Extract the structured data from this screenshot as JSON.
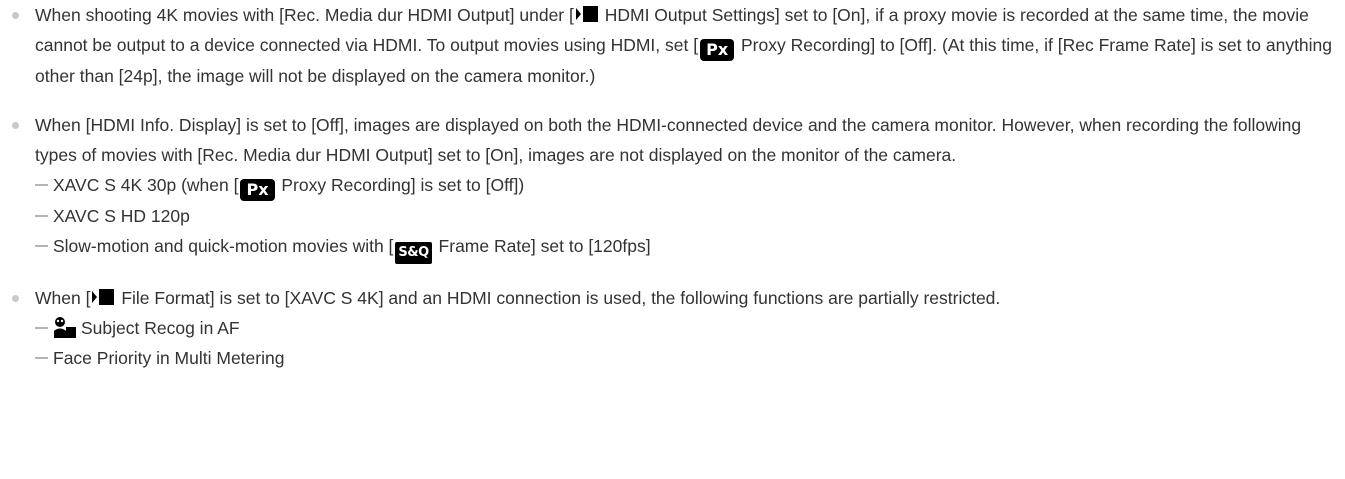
{
  "icons": {
    "movie": "movie-mode-icon",
    "proxy": "Px",
    "sq": "S&Q",
    "face": "subject-recognition-icon"
  },
  "colors": {
    "text": "#333333",
    "badge_bg": "#000000",
    "bullet": "#c8c8c8"
  },
  "note1": {
    "a": "When shooting 4K movies with [Rec. Media dur HDMI Output] under [",
    "b": " HDMI Output Settings] set to [On], if a proxy movie is recorded at the same time, the movie cannot be output to a device connected via HDMI. To output movies using HDMI, set [",
    "c": " Proxy Recording] to [Off]. (At this time, if [Rec Frame Rate] is set to anything other than [24p], the image will not be displayed on the camera monitor.)"
  },
  "note2": {
    "text": "When [HDMI Info. Display] is set to [Off], images are displayed on both the HDMI-connected device and the camera monitor. However, when recording the following types of movies with [Rec. Media dur HDMI Output] set to [On], images are not displayed on the monitor of the camera.",
    "item1": {
      "a": "XAVC S 4K 30p (when [",
      "b": " Proxy Recording] is set to [Off])"
    },
    "item2": "XAVC S HD 120p",
    "item3": {
      "a": "Slow-motion and quick-motion movies with [",
      "b": " Frame Rate] set to [120fps]"
    }
  },
  "note3": {
    "a": "When [",
    "b": " File Format] is set to [XAVC S 4K] and an HDMI connection is used, the following functions are partially restricted.",
    "item1": "Subject Recog in AF",
    "item2": "Face Priority in Multi Metering"
  }
}
